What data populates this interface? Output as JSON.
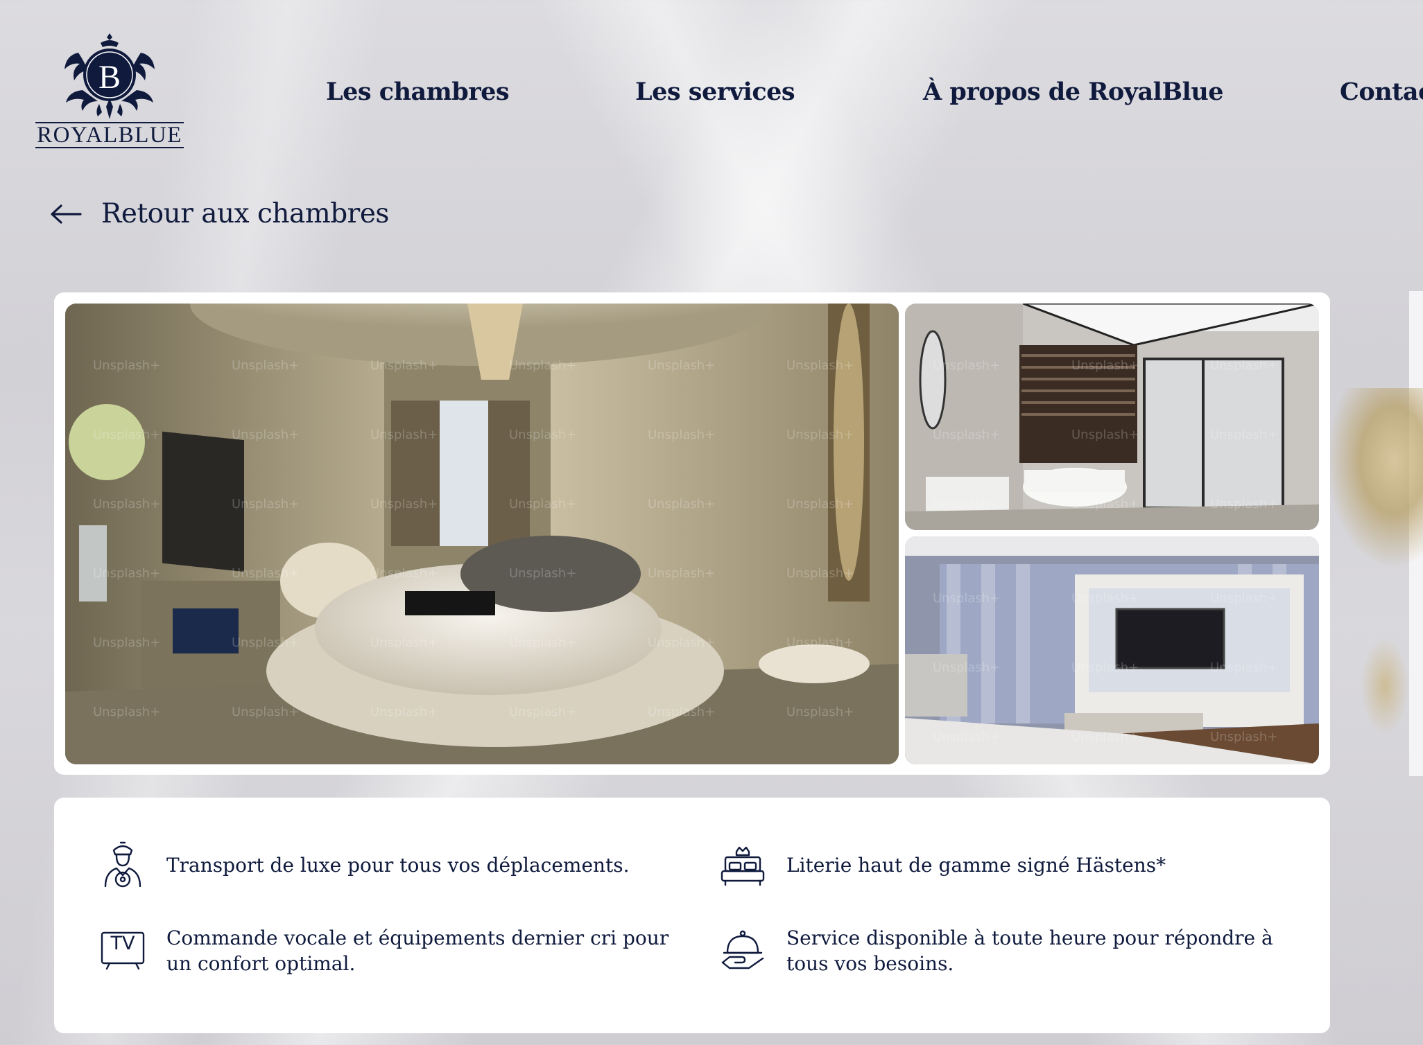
{
  "brand": {
    "initial": "B",
    "name": "ROYALBLUE"
  },
  "nav": [
    {
      "label": "Les chambres"
    },
    {
      "label": "Les services"
    },
    {
      "label": "À propos de RoyalBlue"
    },
    {
      "label": "Contac"
    }
  ],
  "back": {
    "label": "Retour aux chambres"
  },
  "photos": {
    "watermark": "Unsplash+"
  },
  "amenities": [
    {
      "icon": "chauffeur-icon",
      "text": "Transport de luxe pour tous vos déplacements."
    },
    {
      "icon": "bed-icon",
      "text": "Literie haut de gamme signé Hästens*"
    },
    {
      "icon": "tv-icon",
      "icon_text": "TV",
      "text": "Commande vocale et équipements dernier cri pour un confort optimal."
    },
    {
      "icon": "room-service-icon",
      "text": "Service disponible à toute heure pour répondre à tous vos besoins."
    }
  ],
  "colors": {
    "navy": "#0f1a3d",
    "card": "#ffffff"
  }
}
